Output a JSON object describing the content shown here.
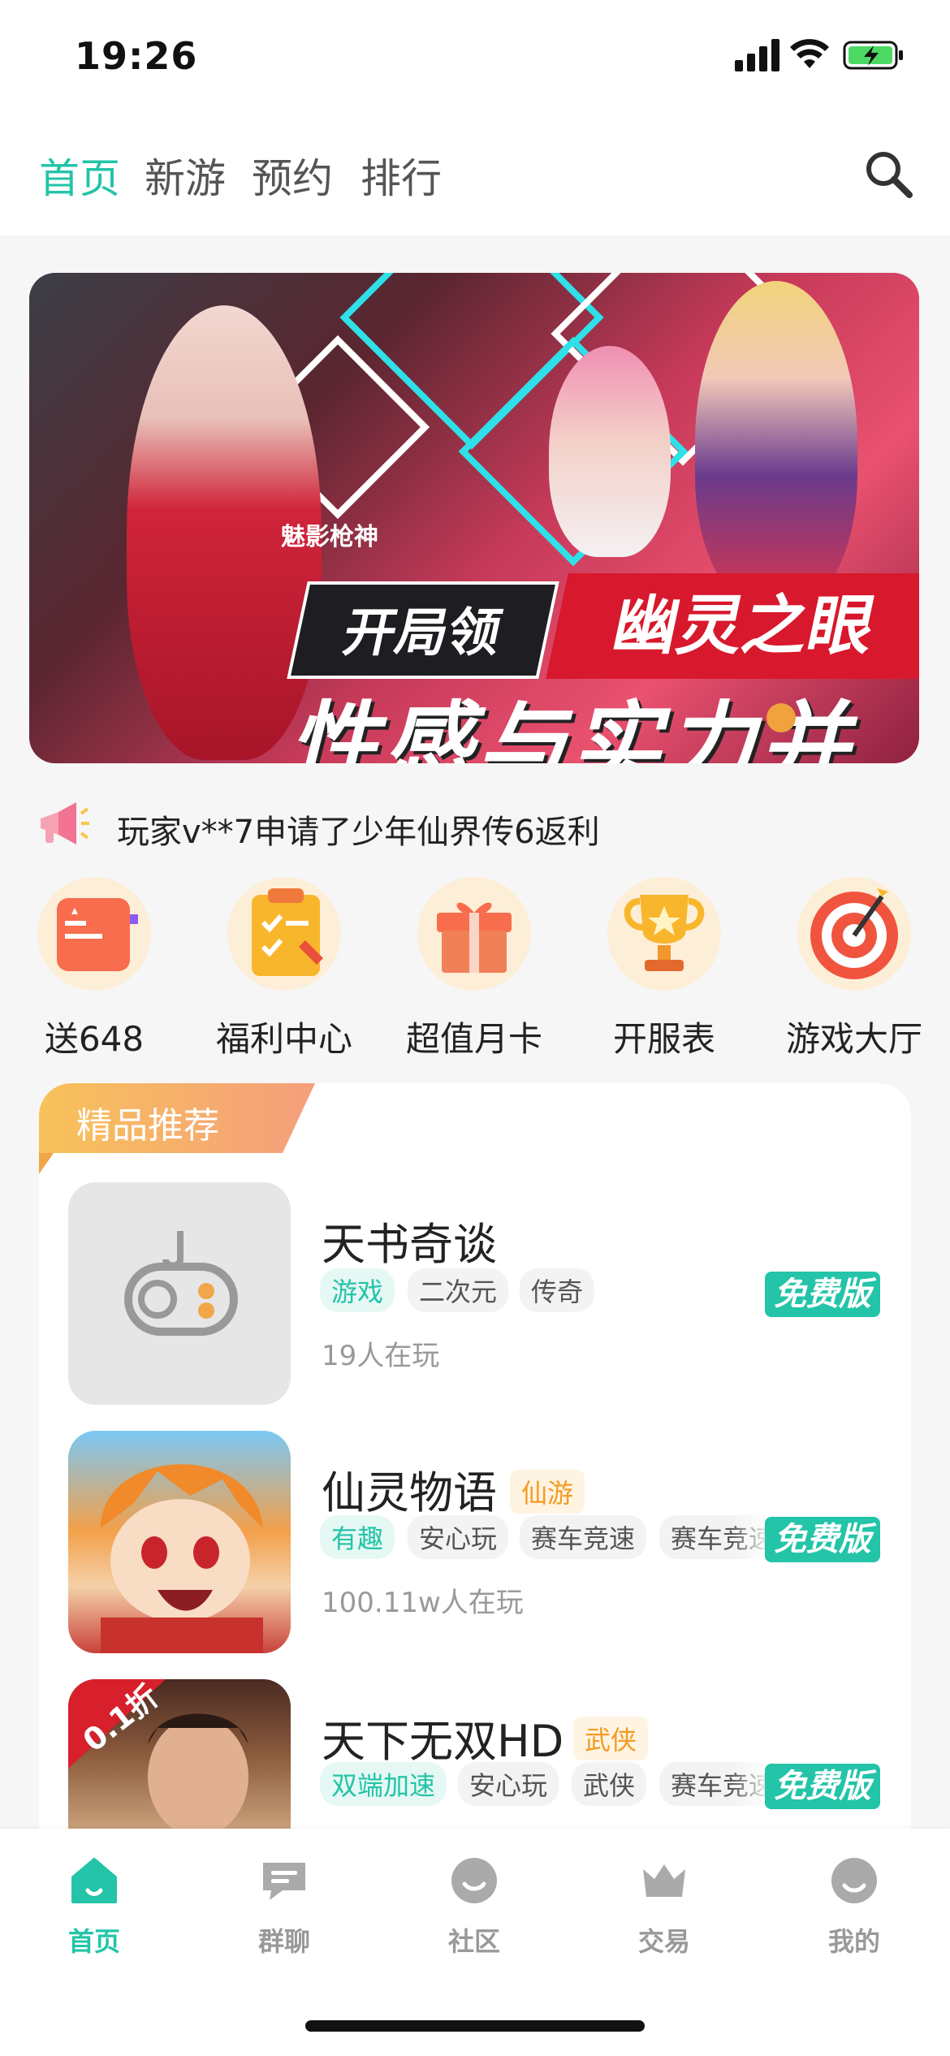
{
  "status_bar": {
    "time": "19:26"
  },
  "top_tabs": [
    {
      "label": "首页",
      "active": true
    },
    {
      "label": "新游",
      "active": false
    },
    {
      "label": "预约",
      "active": false
    },
    {
      "label": "排行",
      "active": false
    }
  ],
  "banner": {
    "tag": "魅影枪神",
    "text_left": "开局领",
    "text_right": "幽灵之眼",
    "text_bottom": "性感与实力并存"
  },
  "notice": "玩家v**7申请了少年仙界传6返利",
  "quick_entries": [
    {
      "label": "送648",
      "icon": "coupon-icon"
    },
    {
      "label": "福利中心",
      "icon": "clipboard-icon"
    },
    {
      "label": "超值月卡",
      "icon": "gift-icon"
    },
    {
      "label": "开服表",
      "icon": "trophy-icon"
    },
    {
      "label": "游戏大厅",
      "icon": "target-icon"
    }
  ],
  "recommend": {
    "title": "精品推荐",
    "games": [
      {
        "name": "天书奇谈",
        "category": "",
        "tags": [
          "游戏",
          "二次元",
          "传奇"
        ],
        "players": "19人在玩",
        "badge": "免费版"
      },
      {
        "name": "仙灵物语",
        "category": "仙游",
        "tags": [
          "有趣",
          "安心玩",
          "赛车竞速",
          "赛车竞速"
        ],
        "players": "100.11w人在玩",
        "badge": "免费版"
      },
      {
        "name": "天下无双HD",
        "category": "武侠",
        "tags": [
          "双端加速",
          "安心玩",
          "武侠",
          "赛车竞速"
        ],
        "players": "",
        "badge": "免费版"
      }
    ],
    "game3_icon_text": "0.1折"
  },
  "bottom_nav": [
    {
      "label": "首页",
      "active": true
    },
    {
      "label": "群聊",
      "active": false
    },
    {
      "label": "社区",
      "active": false
    },
    {
      "label": "交易",
      "active": false
    },
    {
      "label": "我的",
      "active": false
    }
  ],
  "colors": {
    "accent": "#23c4a8",
    "orange": "#f59a23"
  }
}
